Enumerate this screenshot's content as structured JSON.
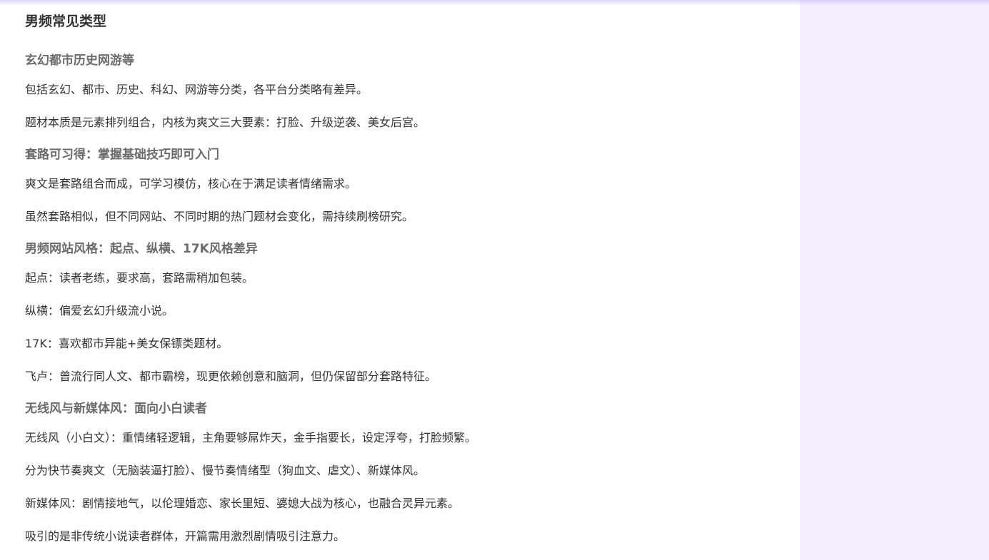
{
  "doc": {
    "title": "男频常见类型",
    "sections": [
      {
        "heading": "玄幻都市历史网游等",
        "paragraphs": [
          "包括玄幻、都市、历史、科幻、网游等分类，各平台分类略有差异。",
          "题材本质是元素排列组合，内核为爽文三大要素：打脸、升级逆袭、美女后宫。"
        ]
      },
      {
        "heading": "套路可习得：掌握基础技巧即可入门",
        "paragraphs": [
          "爽文是套路组合而成，可学习模仿，核心在于满足读者情绪需求。",
          "虽然套路相似，但不同网站、不同时期的热门题材会变化，需持续刷榜研究。"
        ]
      },
      {
        "heading": "男频网站风格：起点、纵横、17K风格差异",
        "paragraphs": [
          "起点：读者老练，要求高，套路需稍加包装。",
          "纵横：偏爱玄幻升级流小说。",
          "17K：喜欢都市异能+美女保镖类题材。",
          "飞卢：曾流行同人文、都市霸榜，现更依赖创意和脑洞，但仍保留部分套路特征。"
        ]
      },
      {
        "heading": "无线风与新媒体风：面向小白读者",
        "paragraphs": [
          "无线风（小白文）：重情绪轻逻辑，主角要够屌炸天，金手指要长，设定浮夸，打脸频繁。",
          "分为快节奏爽文（无脑装逼打脸）、慢节奏情绪型（狗血文、虐文）、新媒体风。",
          "新媒体风：剧情接地气，以伦理婚恋、家长里短、婆媳大战为核心，也融合灵异元素。",
          "吸引的是非传统小说读者群体，开篇需用激烈剧情吸引注意力。"
        ]
      }
    ]
  }
}
